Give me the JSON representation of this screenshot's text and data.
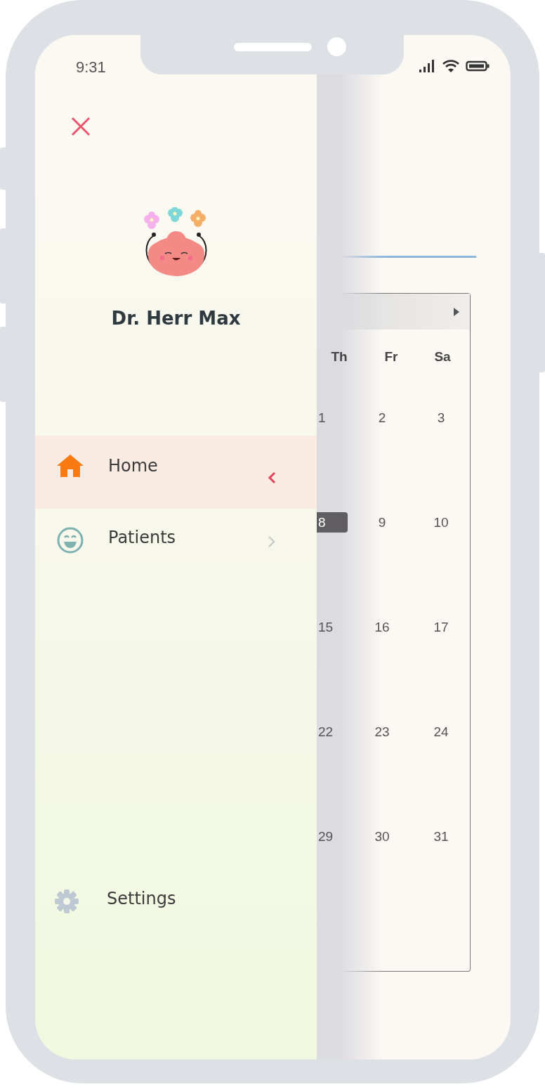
{
  "status_bar": {
    "time": "9:31"
  },
  "drawer": {
    "user_name": "Dr. Herr Max",
    "items": [
      {
        "label": "Home",
        "kind": "home",
        "selected": true
      },
      {
        "label": "Patients",
        "kind": "patients",
        "selected": false
      }
    ],
    "footer_item": {
      "label": "Settings",
      "kind": "settings"
    }
  },
  "calendar": {
    "weekdays": [
      "Th",
      "Fr",
      "Sa"
    ],
    "weeks": [
      [
        {
          "day": "1",
          "selected": false
        },
        {
          "day": "2",
          "selected": false
        },
        {
          "day": "3",
          "selected": false
        }
      ],
      [
        {
          "day": "8",
          "selected": true
        },
        {
          "day": "9",
          "selected": false
        },
        {
          "day": "10",
          "selected": false
        }
      ],
      [
        {
          "day": "15",
          "selected": false
        },
        {
          "day": "16",
          "selected": false
        },
        {
          "day": "17",
          "selected": false
        }
      ],
      [
        {
          "day": "22",
          "selected": false
        },
        {
          "day": "23",
          "selected": false
        },
        {
          "day": "24",
          "selected": false
        }
      ],
      [
        {
          "day": "29",
          "selected": false
        },
        {
          "day": "30",
          "selected": false
        },
        {
          "day": "31",
          "selected": false
        }
      ]
    ]
  }
}
